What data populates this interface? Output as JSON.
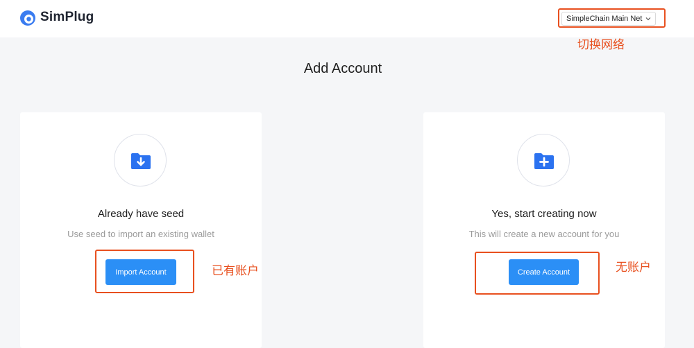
{
  "app": {
    "name": "SimPlug"
  },
  "network": {
    "selected": "SimpleChain Main Net"
  },
  "page": {
    "title": "Add Account"
  },
  "cards": [
    {
      "icon": "folder-download-icon",
      "heading": "Already have seed",
      "description": "Use seed to import an existing wallet",
      "button": "Import Account"
    },
    {
      "icon": "folder-add-icon",
      "heading": "Yes, start creating now",
      "description": "This will create a new account for you",
      "button": "Create Account"
    }
  ],
  "annotations": {
    "network": "切换网络",
    "import": "已有账户",
    "create": "无账户"
  },
  "colors": {
    "accent": "#2b8ff6",
    "brand_icon": "#3a7cf0",
    "annotation": "#e8501f",
    "background": "#f5f6f8"
  }
}
